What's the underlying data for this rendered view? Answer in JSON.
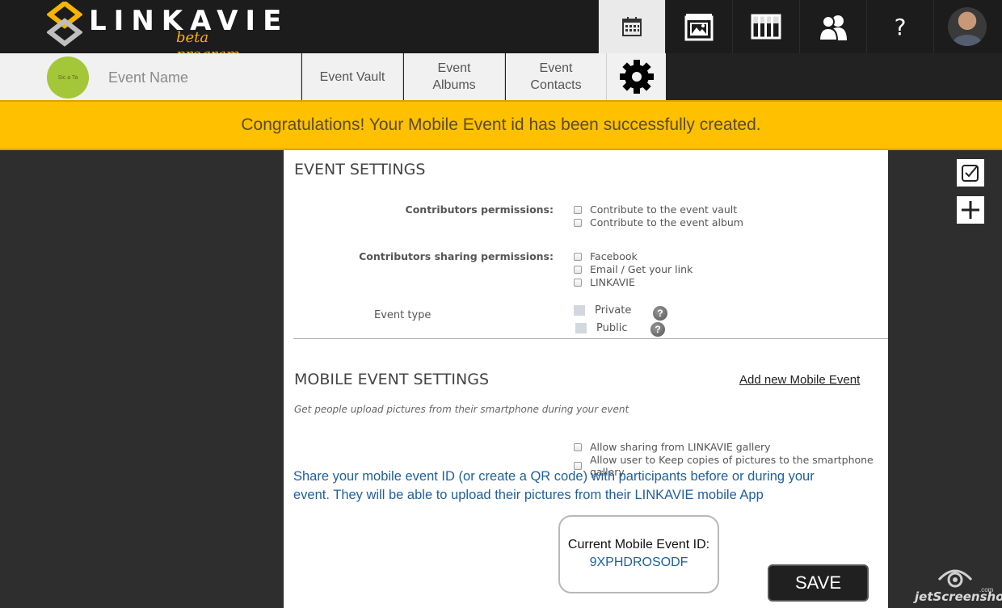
{
  "header": {
    "logo_text": "LINKAVIE",
    "logo_subtitle": "beta program",
    "nav_icons": [
      "calendar-icon",
      "gallery-icon",
      "album-icon",
      "contacts-icon",
      "help-icon",
      "user-avatar"
    ],
    "help_label": "?"
  },
  "event_bar": {
    "event_logo_text": "Sic a Ta",
    "event_name": "Event Name",
    "tabs": [
      {
        "label": "Event Vault"
      },
      {
        "label": "Event\nAlbums"
      },
      {
        "label": "Event\nContacts"
      }
    ]
  },
  "banner": {
    "message": "Congratulations! Your Mobile Event  id has been successfully created."
  },
  "event_settings": {
    "title": "EVENT SETTINGS",
    "contributors_permissions_label": "Contributors permissions:",
    "contributors_permissions": [
      "Contribute to the event vault",
      "Contribute to the event album"
    ],
    "sharing_permissions_label": "Contributors sharing permissions:",
    "sharing_permissions": [
      "Facebook",
      "Email / Get your link",
      "LINKAVIE"
    ],
    "event_type_label": "Event type",
    "event_types": [
      "Private",
      "Public"
    ]
  },
  "mobile_settings": {
    "title": "MOBILE EVENT SETTINGS",
    "add_link": "Add new Mobile Event",
    "subtitle": "Get people upload pictures from their smartphone during your event",
    "options": [
      "Allow sharing from LINKAVIE gallery",
      "Allow user to Keep copies of pictures to the smartphone gallery"
    ],
    "instructions_line1": "Share your mobile event ID (or create a QR code) with participants before or during your",
    "instructions_line2": "event. They will be able to upload their pictures from their LINKAVIE mobile App",
    "current_id_label": "Current Mobile Event ID:",
    "current_id_value": "9XPHDROSODF",
    "save_label": "SAVE"
  },
  "tools": [
    "checklist-icon",
    "plus-icon"
  ],
  "watermark": {
    "text": "jetScreenshot",
    "suffix": ".com"
  },
  "colors": {
    "brand_yellow": "#ffc000",
    "logo_accent": "#f6b400",
    "event_logo_green": "#a4c639",
    "link_blue": "#1f5f9e",
    "topbar_dark": "#1c1c1c"
  }
}
